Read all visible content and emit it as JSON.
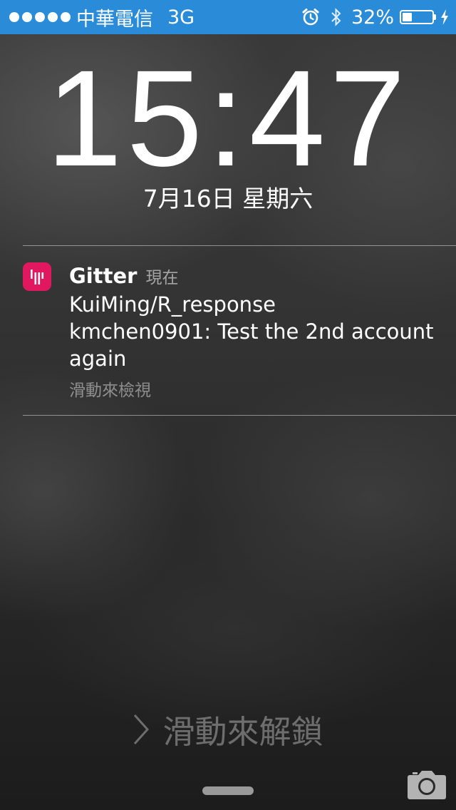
{
  "status_bar": {
    "signal_dots": 5,
    "carrier": "中華電信",
    "network": "3G",
    "alarm_icon": "alarm-icon",
    "bluetooth_icon": "bluetooth-icon",
    "battery_percent": "32%",
    "battery_level": 0.32,
    "charging_icon": "bolt-icon",
    "background_color": "#2a8bd8"
  },
  "lock_screen": {
    "time": "15:47",
    "date": "7月16日 星期六"
  },
  "notification": {
    "app_icon": "gitter-icon",
    "app_icon_color": "#e1185f",
    "app_name": "Gitter",
    "time": "現在",
    "title": "KuiMing/R_response",
    "message": "kmchen0901: Test the 2nd account again",
    "action_hint": "滑動來檢視"
  },
  "unlock": {
    "chevron_icon": "chevron-right-icon",
    "label": "滑動來解鎖",
    "camera_icon": "camera-icon"
  }
}
